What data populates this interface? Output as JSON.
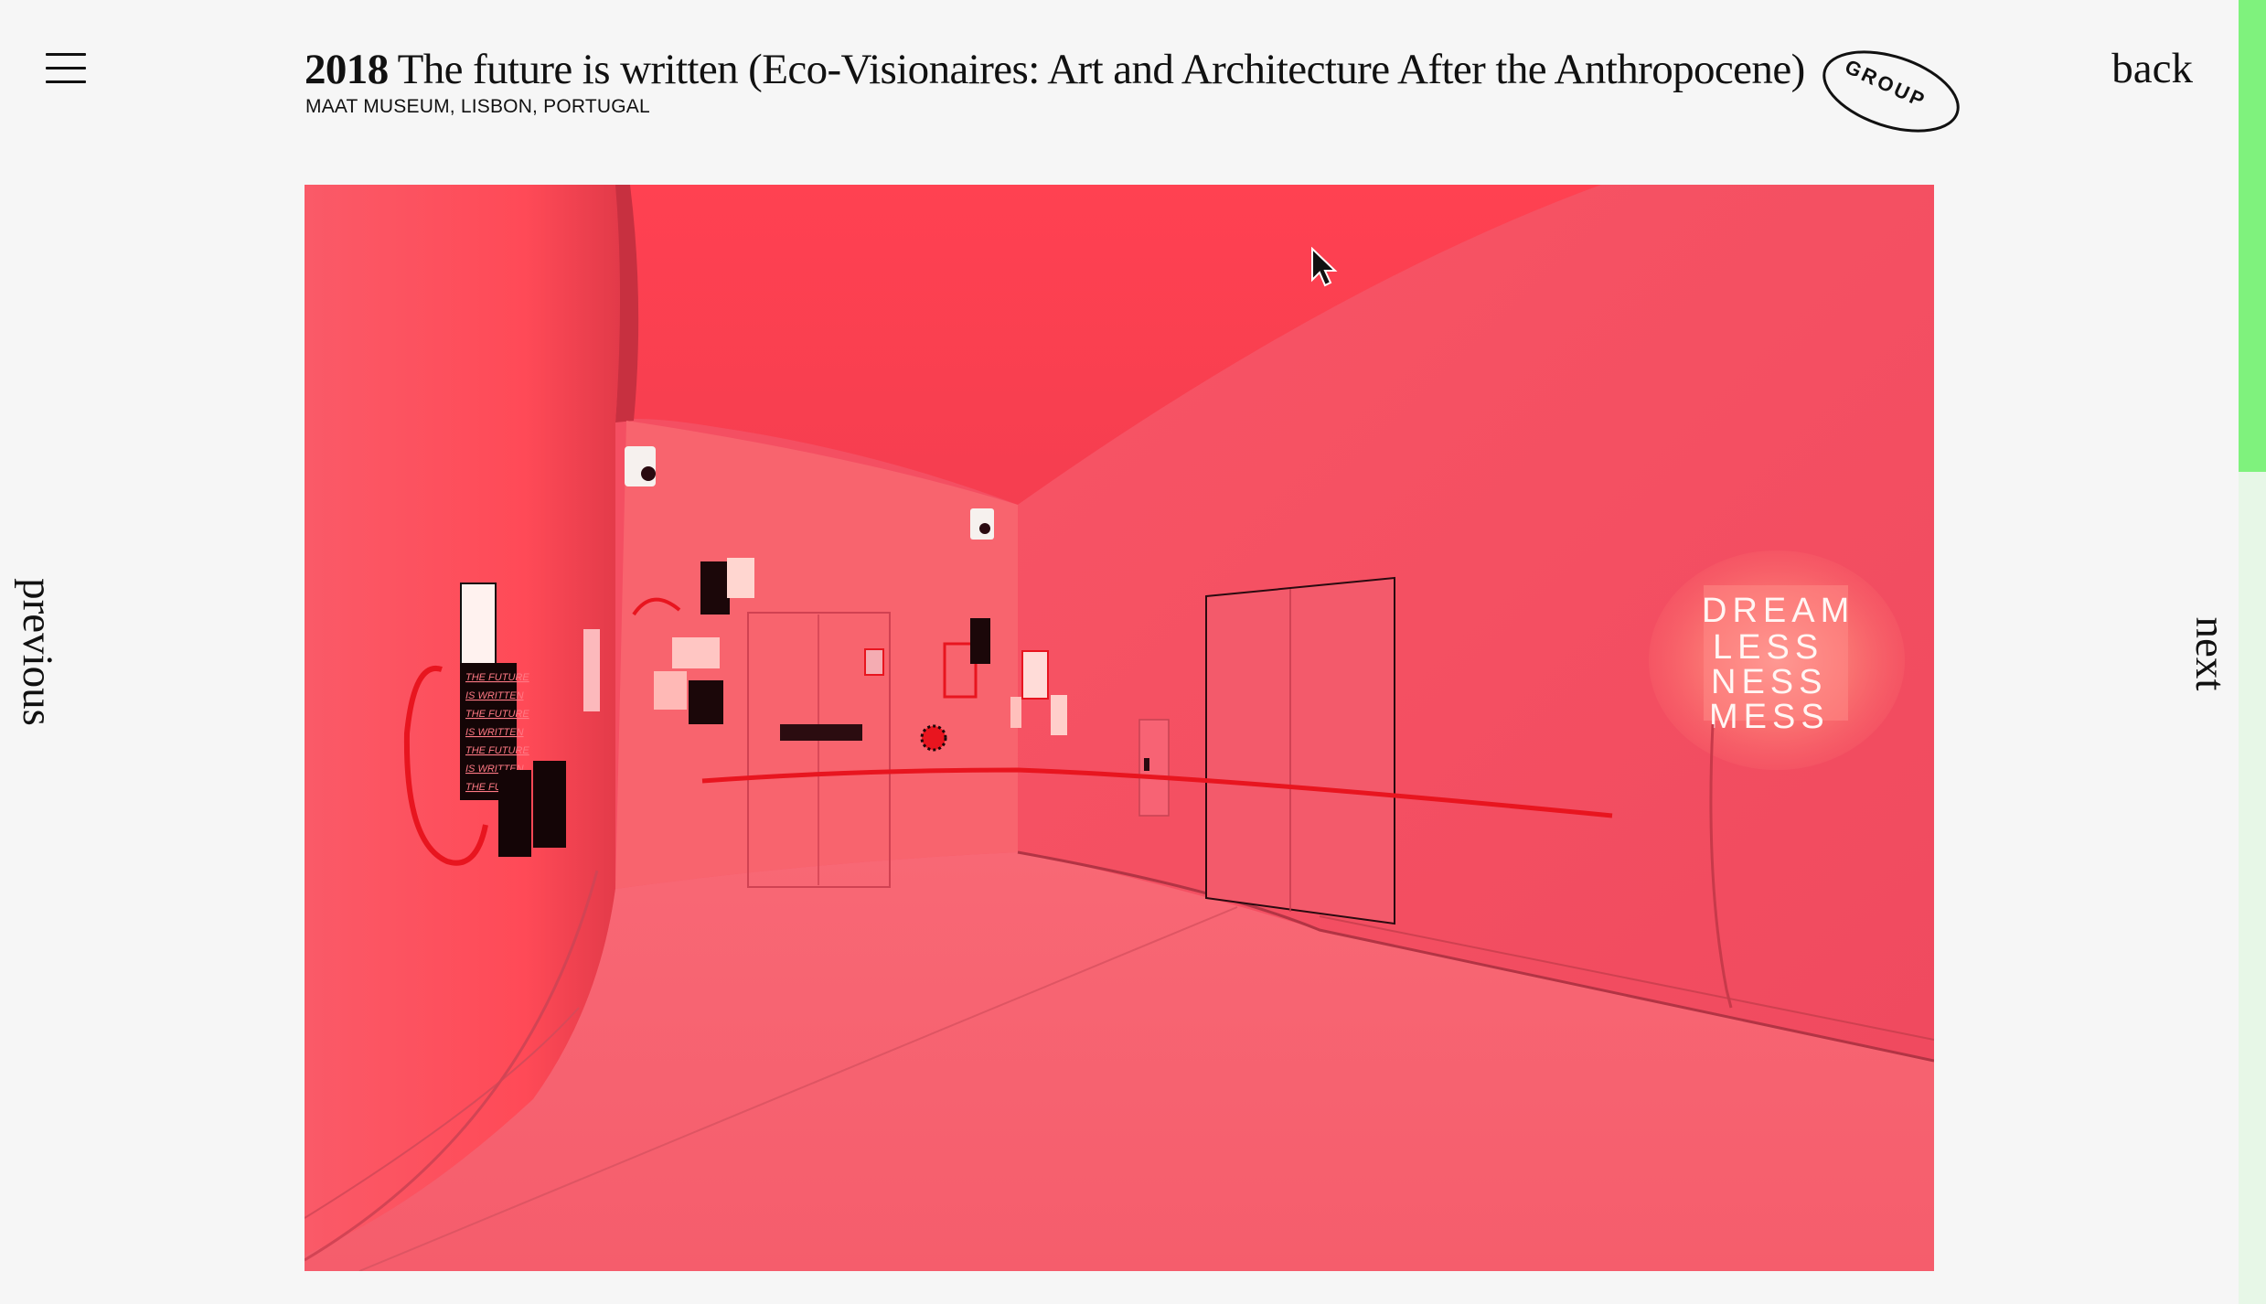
{
  "header": {
    "year": "2018",
    "title": "The future is written (Eco-Visionaires: Art and Architecture After the Anthropocene)",
    "venue": "MAAT MUSEUM, LISBON, PORTUGAL",
    "badge": "GROUP"
  },
  "nav": {
    "back": "back",
    "previous": "previous",
    "next": "next"
  },
  "artwork": {
    "neon_lines": [
      "DREAM",
      "LESS",
      "NESS",
      "MESS"
    ],
    "poster_lines": [
      "THE FUTURE",
      "IS WRITTEN",
      "THE FUTURE",
      "IS WRITTEN",
      "THE FUTURE",
      "IS WRITTEN",
      "THE FU"
    ]
  },
  "scroll": {
    "position_fraction": 0.36
  },
  "colors": {
    "background": "#f6f6f6",
    "scroll_thumb": "#7ff27d",
    "scroll_track": "#e7f7e7",
    "photo_tint": "#f44f62"
  },
  "icons": {
    "menu": "hamburger-menu-icon",
    "cursor": "mouse-pointer-icon"
  }
}
